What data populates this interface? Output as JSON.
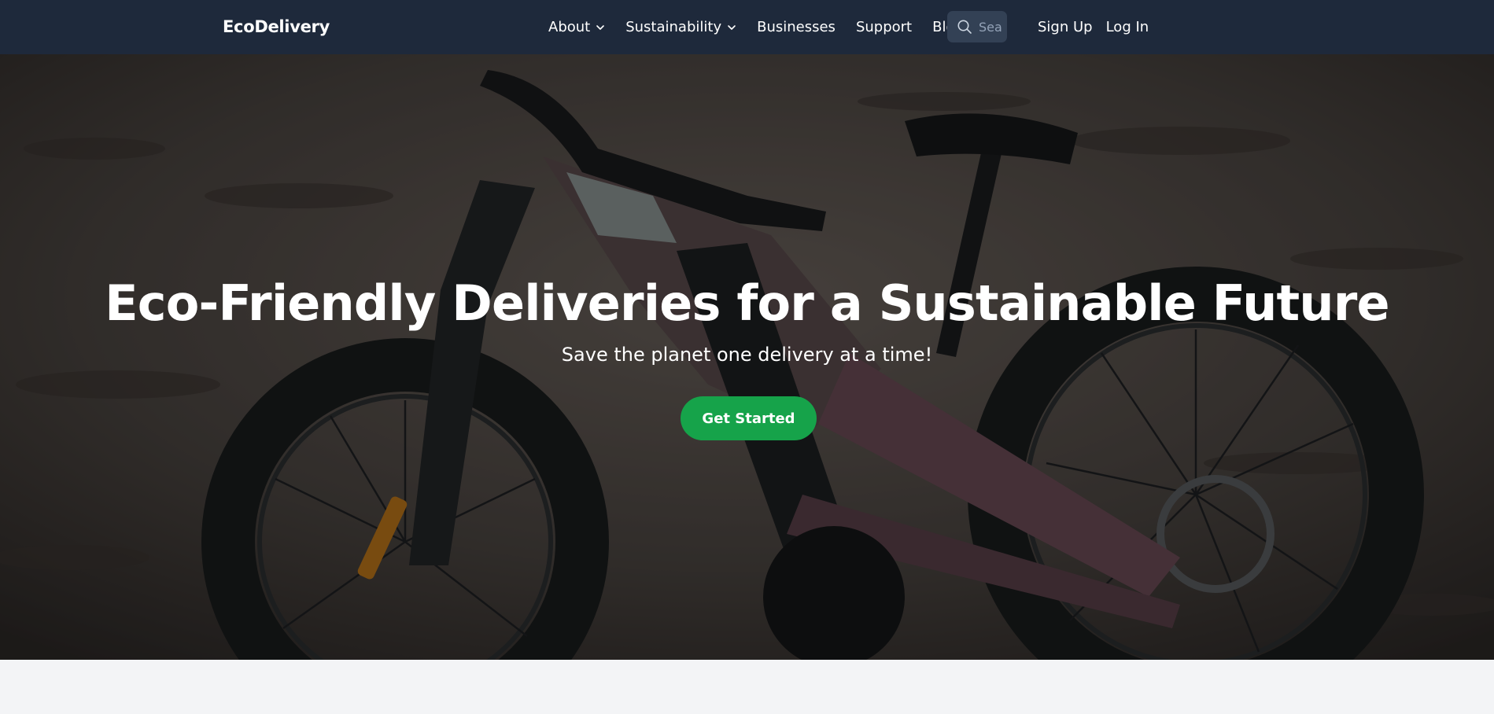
{
  "navbar": {
    "brand": "EcoDelivery",
    "links": [
      {
        "label": "About",
        "has_dropdown": true
      },
      {
        "label": "Sustainability",
        "has_dropdown": true
      },
      {
        "label": "Businesses",
        "has_dropdown": false
      },
      {
        "label": "Support",
        "has_dropdown": false
      },
      {
        "label": "Blog",
        "has_dropdown": false
      }
    ],
    "search": {
      "placeholder": "Search",
      "icon": "search-icon"
    },
    "auth": {
      "sign_up": "Sign Up",
      "log_in": "Log In"
    }
  },
  "hero": {
    "background": "electric fat-tire bike on sand",
    "title": "Eco-Friendly Deliveries for a Sustainable Future",
    "subtitle": "Save the planet one delivery at a time!",
    "cta_label": "Get Started"
  },
  "colors": {
    "navbar_bg": "#1e293b",
    "search_bg": "#334155",
    "cta_bg": "#16a34a",
    "page_bg": "#f3f4f6"
  }
}
